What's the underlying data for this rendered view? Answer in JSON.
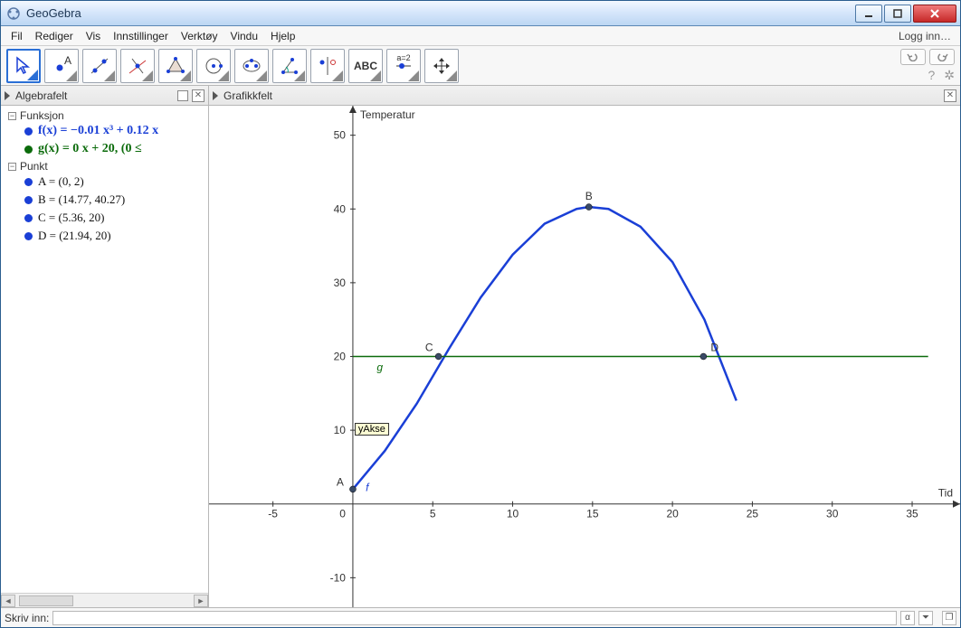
{
  "window": {
    "title": "GeoGebra"
  },
  "menu": {
    "items": [
      "Fil",
      "Rediger",
      "Vis",
      "Innstillinger",
      "Verktøy",
      "Vindu",
      "Hjelp"
    ],
    "login": "Logg inn…"
  },
  "toolbar": {
    "tools": [
      "move",
      "point",
      "line",
      "perpendicular",
      "polygon",
      "circle",
      "ellipse",
      "angle",
      "reflect",
      "text",
      "slider",
      "pan"
    ],
    "selected": 0,
    "text_label": "ABC",
    "slider_label": "a=2"
  },
  "panels": {
    "algebra_title": "Algebrafelt",
    "graphics_title": "Grafikkfelt"
  },
  "algebra": {
    "groups": [
      {
        "name": "Funksjon",
        "items": [
          {
            "kind": "f",
            "text": "f(x)  =  −0.01 x³ + 0.12 x"
          },
          {
            "kind": "g",
            "text": "g(x)  =  0 x + 20,     (0 ≤"
          }
        ]
      },
      {
        "name": "Punkt",
        "items": [
          {
            "kind": "p",
            "text": "A = (0, 2)"
          },
          {
            "kind": "p",
            "text": "B = (14.77, 40.27)"
          },
          {
            "kind": "p",
            "text": "C = (5.36, 20)"
          },
          {
            "kind": "p",
            "text": "D = (21.94, 20)"
          }
        ]
      }
    ]
  },
  "chart_data": {
    "type": "line",
    "title": "",
    "xlabel": "Tid",
    "ylabel": "Temperatur",
    "xlim": [
      -9,
      38
    ],
    "ylim": [
      -14,
      54
    ],
    "xticks": [
      -5,
      0,
      5,
      10,
      15,
      20,
      25,
      30,
      35
    ],
    "yticks": [
      -10,
      0,
      10,
      20,
      30,
      40,
      50
    ],
    "series": [
      {
        "name": "f",
        "color": "#1a3fd6",
        "x": [
          0,
          2,
          4,
          6,
          8,
          10,
          12,
          14,
          14.77,
          16,
          18,
          20,
          22,
          24
        ],
        "y": [
          2,
          7.2,
          13.6,
          21,
          28,
          33.8,
          38,
          40,
          40.27,
          40,
          37.6,
          32.8,
          25,
          14
        ]
      },
      {
        "name": "g",
        "color": "#0b6b0b",
        "x": [
          0,
          38
        ],
        "y": [
          20,
          20
        ]
      }
    ],
    "points": [
      {
        "name": "A",
        "x": 0,
        "y": 2
      },
      {
        "name": "B",
        "x": 14.77,
        "y": 40.27
      },
      {
        "name": "C",
        "x": 5.36,
        "y": 20
      },
      {
        "name": "D",
        "x": 21.94,
        "y": 20
      }
    ],
    "tooltip": "yAkse",
    "curve_labels": {
      "f": "f",
      "g": "g"
    }
  },
  "input": {
    "label": "Skriv inn:",
    "value": "",
    "alpha": "α",
    "arrow": "⏷",
    "popup": "❐"
  }
}
